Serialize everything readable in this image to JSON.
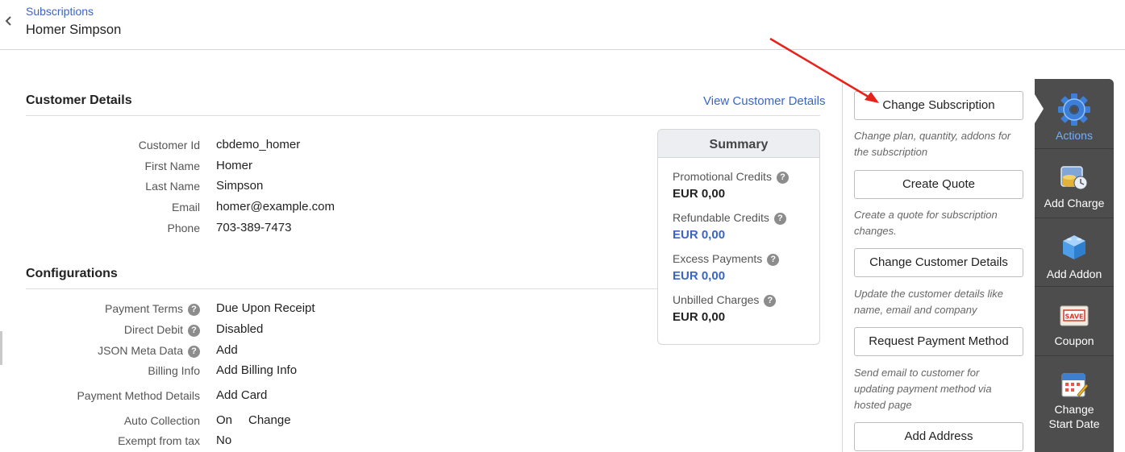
{
  "header": {
    "breadcrumb": "Subscriptions",
    "title": "Homer Simpson"
  },
  "customer_details": {
    "title": "Customer Details",
    "view_link": "View Customer Details",
    "fields": [
      {
        "label": "Customer Id",
        "value": "cbdemo_homer"
      },
      {
        "label": "First Name",
        "value": "Homer"
      },
      {
        "label": "Last Name",
        "value": "Simpson"
      },
      {
        "label": "Email",
        "value": "homer@example.com"
      },
      {
        "label": "Phone",
        "value": "703-389-7473"
      }
    ]
  },
  "configurations": {
    "title": "Configurations",
    "payment_terms": {
      "label": "Payment Terms",
      "value": "Due Upon Receipt"
    },
    "direct_debit": {
      "label": "Direct Debit",
      "value": "Disabled"
    },
    "json_meta": {
      "label": "JSON Meta Data",
      "value": "Add"
    },
    "billing_info": {
      "label": "Billing Info",
      "value": "Add Billing Info"
    },
    "payment_method": {
      "label": "Payment Method Details",
      "value": "Add Card"
    },
    "auto_collection": {
      "label": "Auto Collection",
      "value": "On",
      "action": "Change"
    },
    "exempt_tax": {
      "label": "Exempt from tax",
      "value": "No"
    }
  },
  "summary": {
    "title": "Summary",
    "items": [
      {
        "label": "Promotional Credits",
        "value": "EUR 0,00"
      },
      {
        "label": "Refundable Credits",
        "value": "EUR 0,00"
      },
      {
        "label": "Excess Payments",
        "value": "EUR 0,00"
      },
      {
        "label": "Unbilled Charges",
        "value": "EUR 0,00"
      }
    ]
  },
  "actions": [
    {
      "label": "Change Subscription",
      "desc": [
        "Change plan, quantity, addons for",
        "the subscription"
      ]
    },
    {
      "label": "Create Quote",
      "desc": [
        "Create a quote for subscription",
        "changes."
      ]
    },
    {
      "label": "Change Customer Details",
      "desc": [
        "Update the customer details like",
        "name, email and company"
      ]
    },
    {
      "label": "Request Payment Method",
      "desc": [
        "Send email to customer for",
        "updating payment method via",
        "hosted page"
      ]
    },
    {
      "label": "Add Address",
      "desc": []
    }
  ],
  "sidebar": {
    "items": [
      {
        "label": "Actions",
        "icon": "gear-icon"
      },
      {
        "label": "Add Charge",
        "icon": "coins-icon"
      },
      {
        "label": "Add Addon",
        "icon": "cube-icon"
      },
      {
        "label": "Coupon",
        "icon": "save-coupon-icon"
      },
      {
        "label_line1": "Change",
        "label_line2": "Start Date",
        "icon": "calendar-icon"
      }
    ]
  },
  "colors": {
    "link": "#3a65c4",
    "sidebar_bg": "#4d4d4d",
    "sidebar_active": "#6fb0ff",
    "annotation_arrow": "#e8221b"
  }
}
